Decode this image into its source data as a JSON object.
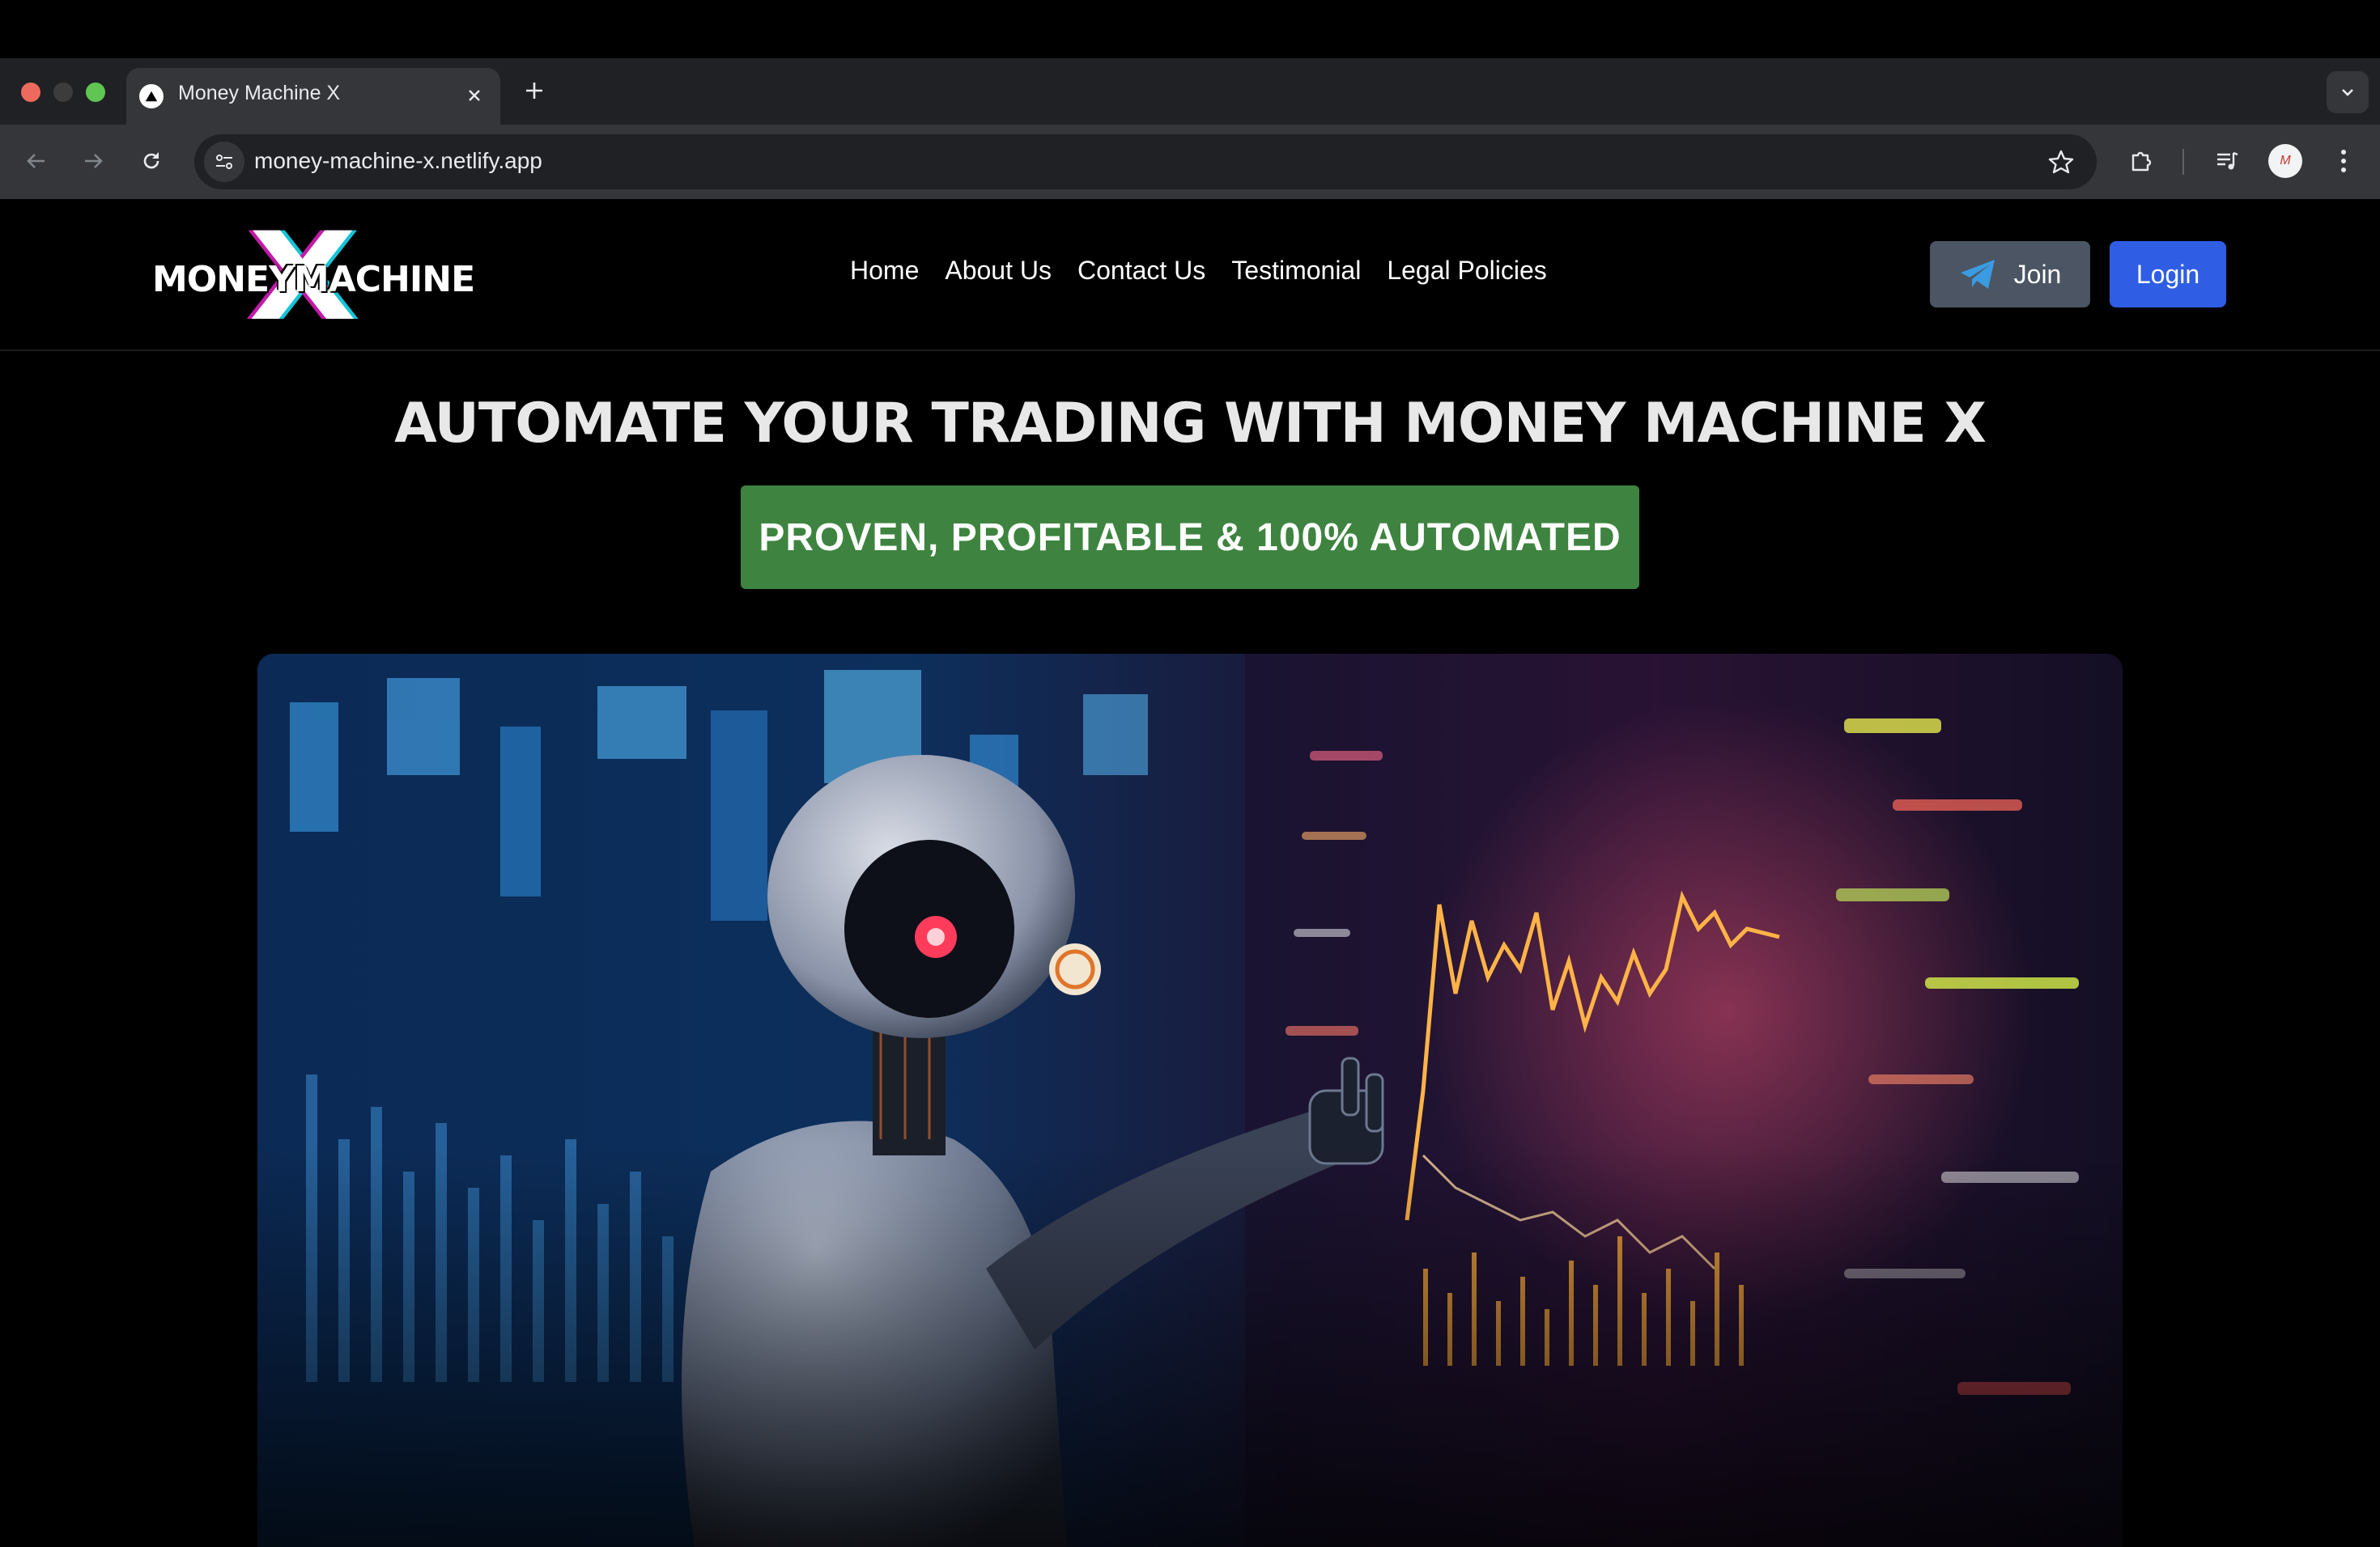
{
  "browser": {
    "tab_title": "Money Machine X",
    "url": "money-machine-x.netlify.app",
    "profile_initials": "M"
  },
  "site": {
    "logo": {
      "text": "MONEYMACHINE",
      "mark": "X"
    },
    "nav": [
      {
        "label": "Home"
      },
      {
        "label": "About Us"
      },
      {
        "label": "Contact Us"
      },
      {
        "label": "Testimonial"
      },
      {
        "label": "Legal Policies"
      }
    ],
    "join_label": "Join",
    "login_label": "Login",
    "colors": {
      "join_bg": "#4b5563",
      "login_bg": "#2f5ee5",
      "badge_bg": "#3e8440"
    }
  },
  "hero": {
    "title": "AUTOMATE YOUR TRADING WITH MONEY MACHINE X",
    "badge": "PROVEN, PROFITABLE & 100% AUTOMATED",
    "image": "robot-trading-chart-image"
  }
}
